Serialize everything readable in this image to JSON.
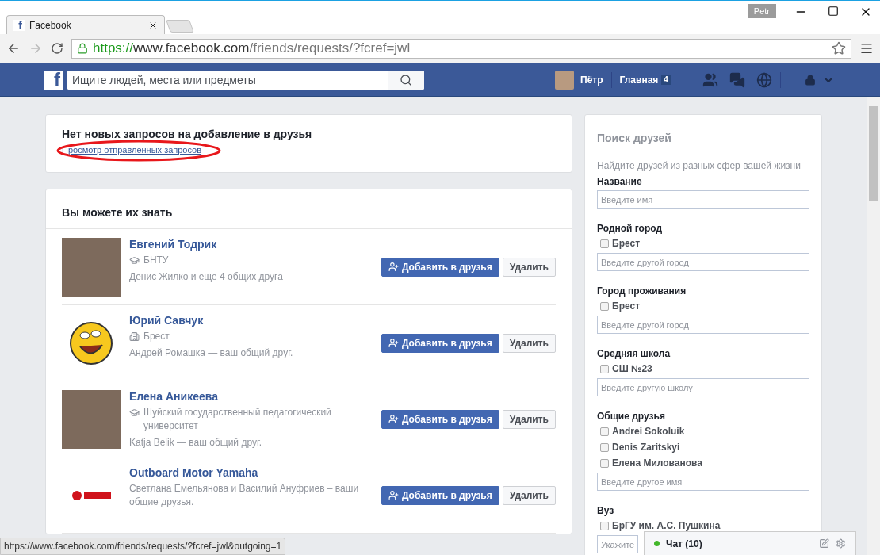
{
  "browser": {
    "tabs": [
      {
        "title": "Facebook",
        "favicon": "f",
        "selected": true
      }
    ],
    "profile_badge": "Petr",
    "url": {
      "scheme": "https://",
      "host": "www.facebook.com",
      "path": "/friends/requests/?fcref=jwl"
    }
  },
  "topbar": {
    "logo": "f",
    "search_placeholder": "Ищите людей, места или предметы",
    "user": "Пётр",
    "home": "Главная",
    "home_badge": "4"
  },
  "requests_card": {
    "title": "Нет новых запросов на добавление в друзья",
    "link": "Просмотр отправленных запросов",
    "circled": true
  },
  "suggestions": {
    "title": "Вы можете их знать",
    "people": [
      {
        "name": "Евгений Тодрик",
        "kind": "photo",
        "detail": {
          "kind": "education",
          "text": "БНТУ"
        },
        "mutual": "Денис Жилко и еще 4 общих друга",
        "add_button": "Добавить в друзья",
        "remove_button": "Удалить"
      },
      {
        "name": "Юрий Савчук",
        "kind": "cartoon",
        "detail": {
          "kind": "city",
          "text": "Брест"
        },
        "mutual": "Андрей Ромашка — ваш общий друг.",
        "add_button": "Добавить в друзья",
        "remove_button": "Удалить"
      },
      {
        "name": "Елена Аникеева",
        "kind": "photo",
        "detail": {
          "kind": "education",
          "text": "Шуйский государственный педагогический университет"
        },
        "mutual": "Katja Belik — ваш общий друг.",
        "add_button": "Добавить в друзья",
        "remove_button": "Удалить"
      },
      {
        "name": "Outboard Motor Yamaha",
        "kind": "logo",
        "mutual": "Светлана Емельянова и Василий Ануфриев – ваши общие друзья.",
        "add_button": "Добавить в друзья",
        "remove_button": "Удалить"
      }
    ]
  },
  "friend_search": {
    "title": "Поиск друзей",
    "subtitle": "Найдите друзей из разных сфер вашей жизни",
    "sections": [
      {
        "label": "Название",
        "placeholder": "Введите имя"
      },
      {
        "label": "Родной город",
        "options": [
          {
            "label": "Брест",
            "checked": false
          }
        ],
        "placeholder": "Введите другой город"
      },
      {
        "label": "Город проживания",
        "options": [
          {
            "label": "Брест",
            "checked": false
          }
        ],
        "placeholder": "Введите другой город"
      },
      {
        "label": "Средняя школа",
        "options": [
          {
            "label": "СШ №23",
            "checked": false
          }
        ],
        "placeholder": "Введите другую школу"
      },
      {
        "label": "Общие друзья",
        "options": [
          {
            "label": "Andrei Sokoluik",
            "checked": false
          },
          {
            "label": "Denis Zaritskyi",
            "checked": false
          },
          {
            "label": "Елена Милованова",
            "checked": false
          }
        ],
        "placeholder": "Введите другое имя"
      },
      {
        "label": "Вуз",
        "options": [
          {
            "label": "БрГУ им. А.С. Пушкина",
            "checked": false
          }
        ],
        "placeholder": "Укажите"
      }
    ]
  },
  "status_url": "https://www.facebook.com/friends/requests/?fcref=jwl&outgoing=1",
  "chat": {
    "label": "Чат (10)",
    "online": true
  }
}
